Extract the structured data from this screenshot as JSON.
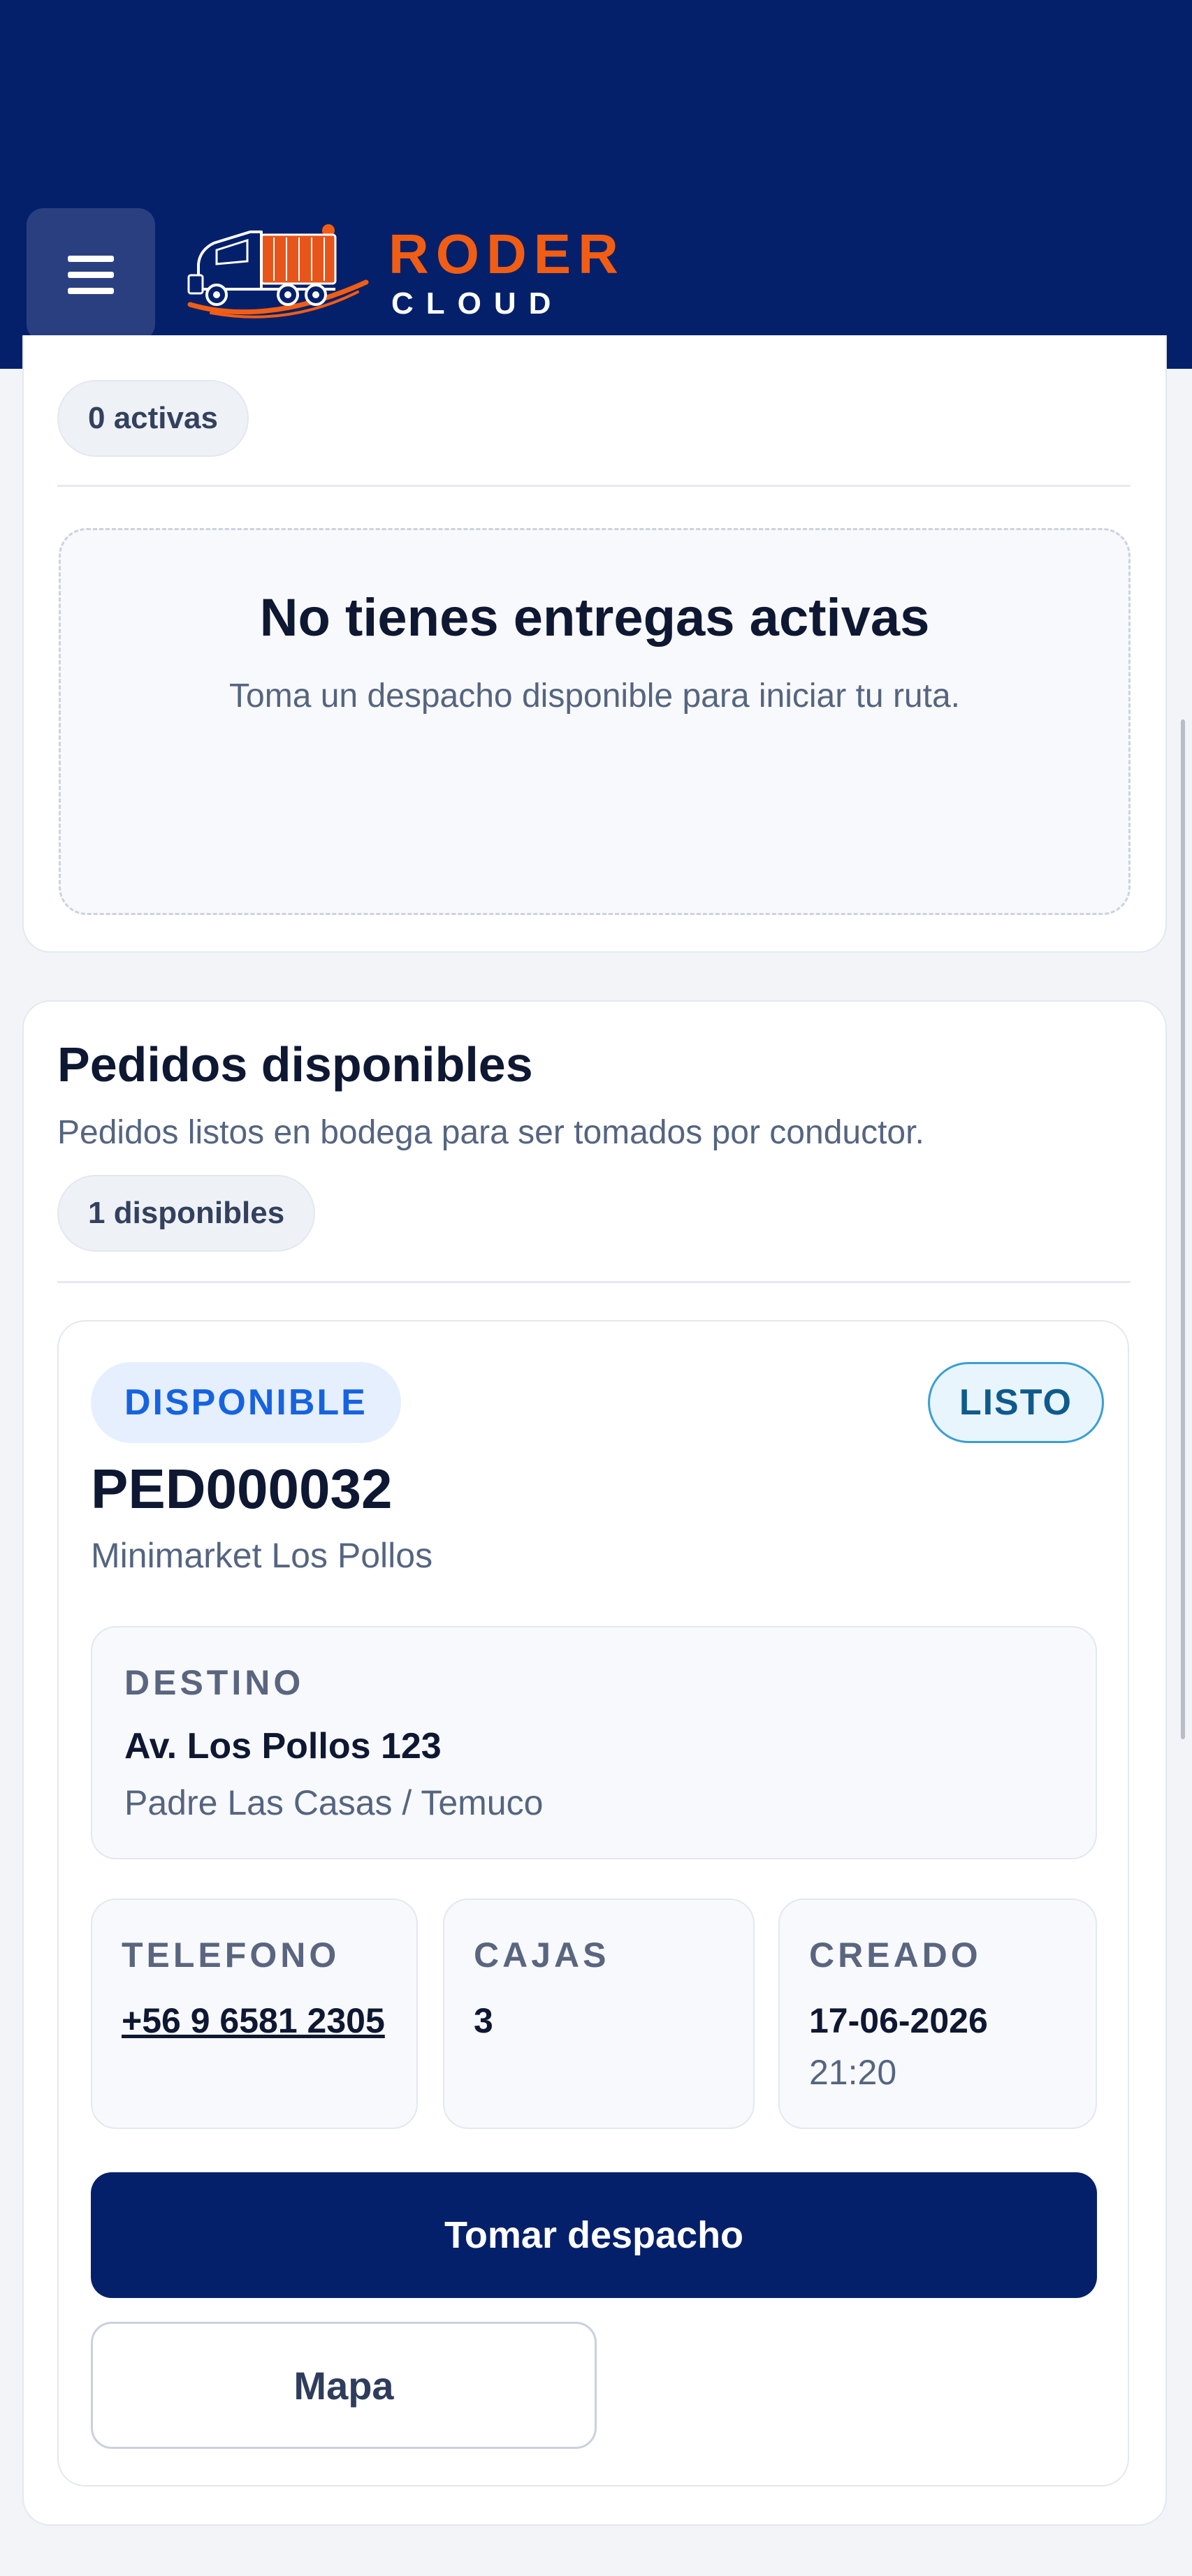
{
  "header": {
    "brand_name": "RODER",
    "brand_sub": "CLOUD",
    "menu_icon": "hamburger-icon",
    "logo_icon": "truck-logo-icon",
    "background_color": "#04206b",
    "accent_color": "#f25d14"
  },
  "active_section": {
    "count_badge": "0 activas",
    "empty_title": "No tienes entregas activas",
    "empty_message": "Toma un despacho disponible para iniciar tu ruta."
  },
  "available_section": {
    "title": "Pedidos disponibles",
    "subtitle": "Pedidos listos en bodega para ser tomados por conductor.",
    "count_badge": "1 disponibles",
    "orders": [
      {
        "status": "DISPONIBLE",
        "state": "LISTO",
        "id": "PED000032",
        "client": "Minimarket Los Pollos",
        "destination_label": "DESTINO",
        "destination_address": "Av. Los Pollos 123",
        "destination_area": "Padre Las Casas / Temuco",
        "phone_label": "TELEFONO",
        "phone": "+56 9 6581 2305",
        "boxes_label": "CAJAS",
        "boxes": "3",
        "created_label": "CREADO",
        "created_date": "17-06-2026",
        "created_time": "21:20",
        "take_button": "Tomar despacho",
        "map_button": "Mapa"
      }
    ]
  }
}
